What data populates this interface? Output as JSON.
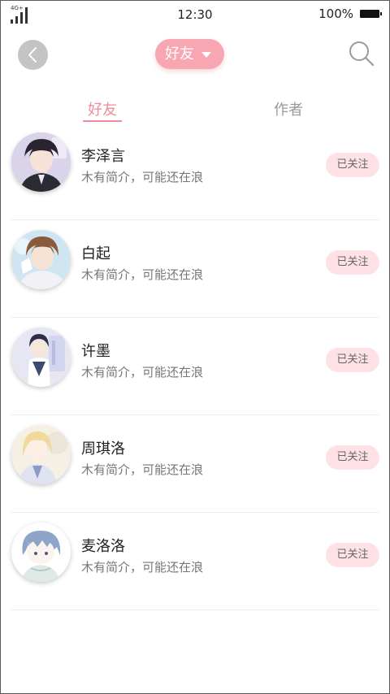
{
  "status_bar": {
    "network": "4G+",
    "time": "12:30",
    "battery": "100%"
  },
  "header": {
    "back_icon": "chevron-left-icon",
    "filter_label": "好友",
    "filter_icon": "caret-down-icon",
    "search_icon": "search-icon",
    "accent_color": "#f8a6b2"
  },
  "tabs": [
    {
      "label": "好友",
      "active": true
    },
    {
      "label": "作者",
      "active": false
    }
  ],
  "friends": [
    {
      "name": "李泽言",
      "bio": "木有简介，可能还在浪",
      "follow_label": "已关注"
    },
    {
      "name": "白起",
      "bio": "木有简介，可能还在浪",
      "follow_label": "已关注"
    },
    {
      "name": "许墨",
      "bio": "木有简介，可能还在浪",
      "follow_label": "已关注"
    },
    {
      "name": "周琪洛",
      "bio": "木有简介，可能还在浪",
      "follow_label": "已关注"
    },
    {
      "name": "麦洛洛",
      "bio": "木有简介，可能还在浪",
      "follow_label": "已关注"
    }
  ]
}
